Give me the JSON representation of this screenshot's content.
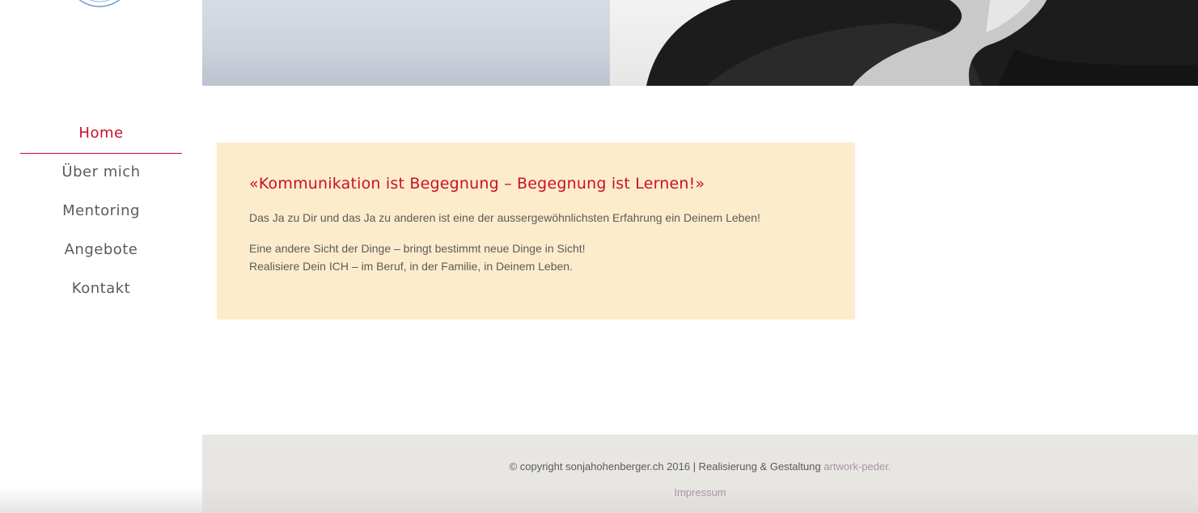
{
  "colors": {
    "accent": "#c8102e",
    "text": "#5b5b5b",
    "quote_bg": "#fdeccb",
    "footer_bg": "#e8e6e2",
    "link": "#a994a8"
  },
  "logo": {
    "icon": "circle-logo-icon"
  },
  "nav": {
    "items": [
      {
        "label": "Home",
        "active": true
      },
      {
        "label": "Über mich",
        "active": false
      },
      {
        "label": "Mentoring",
        "active": false
      },
      {
        "label": "Angebote",
        "active": false
      },
      {
        "label": "Kontakt",
        "active": false
      }
    ]
  },
  "quote": {
    "title": "«Kommunikation ist Begegnung – Begegnung ist Lernen!»",
    "paragraph1": "Das Ja zu Dir und das Ja zu anderen ist eine der aussergewöhnlichsten Erfahrung ein Deinem Leben!",
    "paragraph2_line1": "Eine andere Sicht der Dinge – bringt bestimmt neue Dinge in Sicht!",
    "paragraph2_line2": "Realisiere Dein ICH – im Beruf, in der Familie, in Deinem Leben."
  },
  "footer": {
    "copyright": "© copyright sonjahohenberger.ch 2016 | Realisierung & Gestaltung ",
    "credit_link": "artwork-peder.",
    "impressum": "Impressum"
  }
}
